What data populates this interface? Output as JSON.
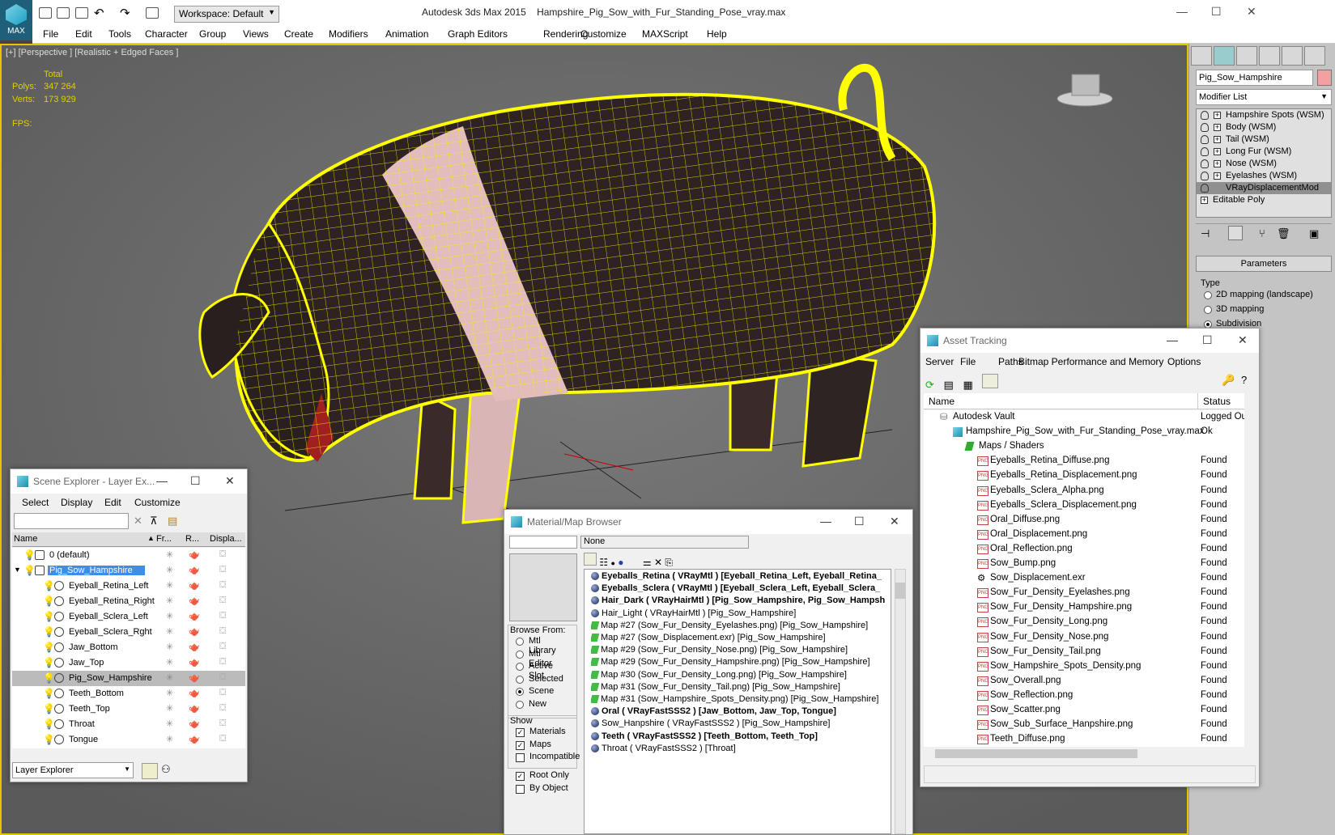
{
  "app": {
    "title": "Autodesk 3ds Max  2015",
    "file": "Hampshire_Pig_Sow_with_Fur_Standing_Pose_vray.max",
    "max_label": "MAX",
    "workspace": "Workspace: Default"
  },
  "menu": [
    "File",
    "Edit",
    "Tools",
    "Character",
    "Group",
    "Views",
    "Create",
    "Modifiers",
    "Animation",
    "Graph Editors",
    "Rendering",
    "Customize",
    "MAXScript",
    "Help"
  ],
  "viewport": {
    "label": "[+] [Perspective ] [Realistic + Edged Faces ]",
    "total": "Total",
    "polys_label": "Polys:",
    "polys": "347 264",
    "verts_label": "Verts:",
    "verts": "173 929",
    "fps_label": "FPS:"
  },
  "command_panel": {
    "object_name": "Pig_Sow_Hampshire",
    "modifier_list": "Modifier List",
    "stack": [
      "Hampshire Spots (WSM)",
      "Body (WSM)",
      "Tail (WSM)",
      "Long Fur (WSM)",
      "Nose (WSM)",
      "Eyelashes (WSM)",
      "VRayDisplacementMod",
      "Editable Poly"
    ],
    "parameters": "Parameters",
    "type_label": "Type",
    "type_options": [
      "2D mapping (landscape)",
      "3D mapping",
      "Subdivision"
    ]
  },
  "scene_explorer": {
    "title": "Scene Explorer - Layer Ex...",
    "menu": [
      "Select",
      "Display",
      "Edit",
      "Customize"
    ],
    "columns": [
      "Name",
      "Fr...",
      "R...",
      "Displa..."
    ],
    "rows": [
      "0 (default)",
      "Pig_Sow_Hampshire",
      "Eyeball_Retina_Left",
      "Eyeball_Retina_Right",
      "Eyeball_Sclera_Left",
      "Eyeball_Sclera_Rght",
      "Jaw_Bottom",
      "Jaw_Top",
      "Pig_Sow_Hampshire",
      "Teeth_Bottom",
      "Teeth_Top",
      "Throat",
      "Tongue"
    ],
    "footer": "Layer Explorer"
  },
  "material_browser": {
    "title": "Material/Map Browser",
    "filter": "None",
    "browse_from": "Browse From:",
    "browse_options": [
      "Mtl Library",
      "Mtl Editor",
      "Active Slot",
      "Selected",
      "Scene",
      "New"
    ],
    "show": "Show",
    "show_options": [
      "Materials",
      "Maps",
      "Incompatible"
    ],
    "root_only": "Root Only",
    "by_object": "By Object",
    "items": [
      {
        "t": "Eyeballs_Retina  ( VRayMtl )  [Eyeball_Retina_Left, Eyeball_Retina_",
        "kind": "mtl",
        "bold": true
      },
      {
        "t": "Eyeballs_Sclera  ( VRayMtl )  [Eyeball_Sclera_Left, Eyeball_Sclera_",
        "kind": "mtl",
        "bold": true
      },
      {
        "t": "Hair_Dark  ( VRayHairMtl )  [Pig_Sow_Hampshire, Pig_Sow_Hampsh",
        "kind": "mtl",
        "bold": true
      },
      {
        "t": "Hair_Light  ( VRayHairMtl )  [Pig_Sow_Hampshire]",
        "kind": "mtl",
        "bold": false
      },
      {
        "t": "Map #27 (Sow_Fur_Density_Eyelashes.png)  [Pig_Sow_Hampshire]",
        "kind": "map",
        "bold": false
      },
      {
        "t": "Map #27 (Sow_Displacement.exr)  [Pig_Sow_Hampshire]",
        "kind": "map",
        "bold": false
      },
      {
        "t": "Map #29 (Sow_Fur_Density_Nose.png)  [Pig_Sow_Hampshire]",
        "kind": "map",
        "bold": false
      },
      {
        "t": "Map #29 (Sow_Fur_Density_Hampshire.png)  [Pig_Sow_Hampshire]",
        "kind": "map",
        "bold": false
      },
      {
        "t": "Map #30 (Sow_Fur_Density_Long.png)  [Pig_Sow_Hampshire]",
        "kind": "map",
        "bold": false
      },
      {
        "t": "Map #31 (Sow_Fur_Density_Tail.png)  [Pig_Sow_Hampshire]",
        "kind": "map",
        "bold": false
      },
      {
        "t": "Map #31 (Sow_Hampshire_Spots_Density.png)  [Pig_Sow_Hampshire]",
        "kind": "map",
        "bold": false
      },
      {
        "t": "Oral  ( VRayFastSSS2 )  [Jaw_Bottom, Jaw_Top, Tongue]",
        "kind": "mtl",
        "bold": true
      },
      {
        "t": "Sow_Hanpshire  ( VRayFastSSS2 )  [Pig_Sow_Hampshire]",
        "kind": "mtl",
        "bold": false
      },
      {
        "t": "Teeth  ( VRayFastSSS2 )  [Teeth_Bottom, Teeth_Top]",
        "kind": "mtl",
        "bold": true
      },
      {
        "t": "Throat  ( VRayFastSSS2 )  [Throat]",
        "kind": "mtl",
        "bold": false
      }
    ]
  },
  "asset_tracking": {
    "title": "Asset Tracking",
    "menu": [
      "Server",
      "File",
      "Paths",
      "Bitmap Performance and Memory",
      "Options"
    ],
    "columns": [
      "Name",
      "Status"
    ],
    "rows": [
      {
        "n": "Autodesk Vault",
        "s": "Logged Ou",
        "lvl": 0,
        "icon": "vault"
      },
      {
        "n": "Hampshire_Pig_Sow_with_Fur_Standing_Pose_vray.max",
        "s": "Ok",
        "lvl": 1,
        "icon": "max"
      },
      {
        "n": "Maps / Shaders",
        "s": "",
        "lvl": 2,
        "icon": "folder"
      },
      {
        "n": "Eyeballs_Retina_Diffuse.png",
        "s": "Found",
        "lvl": 3,
        "icon": "png"
      },
      {
        "n": "Eyeballs_Retina_Displacement.png",
        "s": "Found",
        "lvl": 3,
        "icon": "png"
      },
      {
        "n": "Eyeballs_Sclera_Alpha.png",
        "s": "Found",
        "lvl": 3,
        "icon": "png"
      },
      {
        "n": "Eyeballs_Sclera_Displacement.png",
        "s": "Found",
        "lvl": 3,
        "icon": "png"
      },
      {
        "n": "Oral_Diffuse.png",
        "s": "Found",
        "lvl": 3,
        "icon": "png"
      },
      {
        "n": "Oral_Displacement.png",
        "s": "Found",
        "lvl": 3,
        "icon": "png"
      },
      {
        "n": "Oral_Reflection.png",
        "s": "Found",
        "lvl": 3,
        "icon": "png"
      },
      {
        "n": "Sow_Bump.png",
        "s": "Found",
        "lvl": 3,
        "icon": "png"
      },
      {
        "n": "Sow_Displacement.exr",
        "s": "Found",
        "lvl": 3,
        "icon": "exr"
      },
      {
        "n": "Sow_Fur_Density_Eyelashes.png",
        "s": "Found",
        "lvl": 3,
        "icon": "png"
      },
      {
        "n": "Sow_Fur_Density_Hampshire.png",
        "s": "Found",
        "lvl": 3,
        "icon": "png"
      },
      {
        "n": "Sow_Fur_Density_Long.png",
        "s": "Found",
        "lvl": 3,
        "icon": "png"
      },
      {
        "n": "Sow_Fur_Density_Nose.png",
        "s": "Found",
        "lvl": 3,
        "icon": "png"
      },
      {
        "n": "Sow_Fur_Density_Tail.png",
        "s": "Found",
        "lvl": 3,
        "icon": "png"
      },
      {
        "n": "Sow_Hampshire_Spots_Density.png",
        "s": "Found",
        "lvl": 3,
        "icon": "png"
      },
      {
        "n": "Sow_Overall.png",
        "s": "Found",
        "lvl": 3,
        "icon": "png"
      },
      {
        "n": "Sow_Reflection.png",
        "s": "Found",
        "lvl": 3,
        "icon": "png"
      },
      {
        "n": "Sow_Scatter.png",
        "s": "Found",
        "lvl": 3,
        "icon": "png"
      },
      {
        "n": "Sow_Sub_Surface_Hanpshire.png",
        "s": "Found",
        "lvl": 3,
        "icon": "png"
      },
      {
        "n": "Teeth_Diffuse.png",
        "s": "Found",
        "lvl": 3,
        "icon": "png"
      }
    ]
  }
}
